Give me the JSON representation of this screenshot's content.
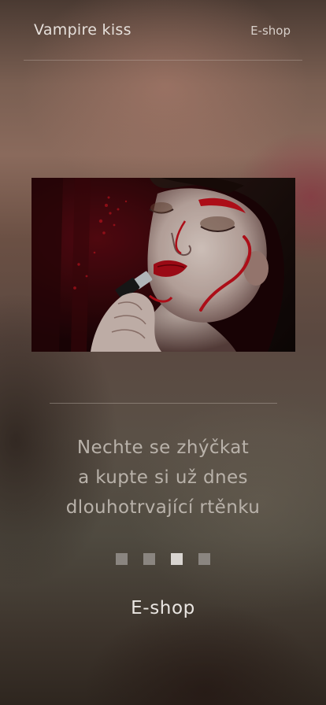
{
  "header": {
    "brand": "Vampire kiss",
    "nav_link": "E-shop"
  },
  "hero": {
    "image_description_icon": "lipstick-model-photo"
  },
  "headline": {
    "lines": [
      "Nechte se zhýčkat",
      "a kupte si už dnes",
      "dlouhotrvající rtěnku"
    ]
  },
  "carousel": {
    "slide_count": 4,
    "active_index": 2
  },
  "cta": {
    "label": "E-shop"
  },
  "colors": {
    "accent_red": "#c4101c",
    "text_light": "#e6e0db",
    "dot_inactive": "#8a8580",
    "dot_active": "#d9d5d1"
  }
}
